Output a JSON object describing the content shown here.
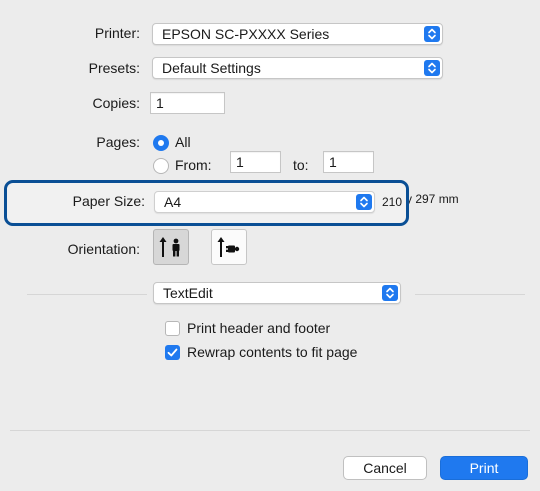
{
  "printer": {
    "label": "Printer:",
    "value": "EPSON SC-PXXXX Series"
  },
  "presets": {
    "label": "Presets:",
    "value": "Default Settings"
  },
  "copies": {
    "label": "Copies:",
    "value": "1"
  },
  "pages": {
    "label": "Pages:",
    "all_label": "All",
    "from_label": "From:",
    "from_value": "1",
    "to_label": "to:",
    "to_value": "1"
  },
  "paper_size": {
    "label": "Paper Size:",
    "value": "A4",
    "dimensions_a": "210",
    "dimensions_b": "y 297 mm"
  },
  "orientation": {
    "label": "Orientation:",
    "options": [
      "portrait-icon",
      "landscape-icon"
    ],
    "selected": "portrait-icon"
  },
  "app_menu": {
    "value": "TextEdit"
  },
  "options": {
    "print_header_footer": {
      "label": "Print header and footer",
      "checked": false
    },
    "rewrap": {
      "label": "Rewrap contents to fit page",
      "checked": true
    }
  },
  "buttons": {
    "cancel": "Cancel",
    "print": "Print"
  },
  "colors": {
    "accent": "#1f79ef",
    "highlight_outline": "#0a4f95",
    "background": "#ececec"
  }
}
